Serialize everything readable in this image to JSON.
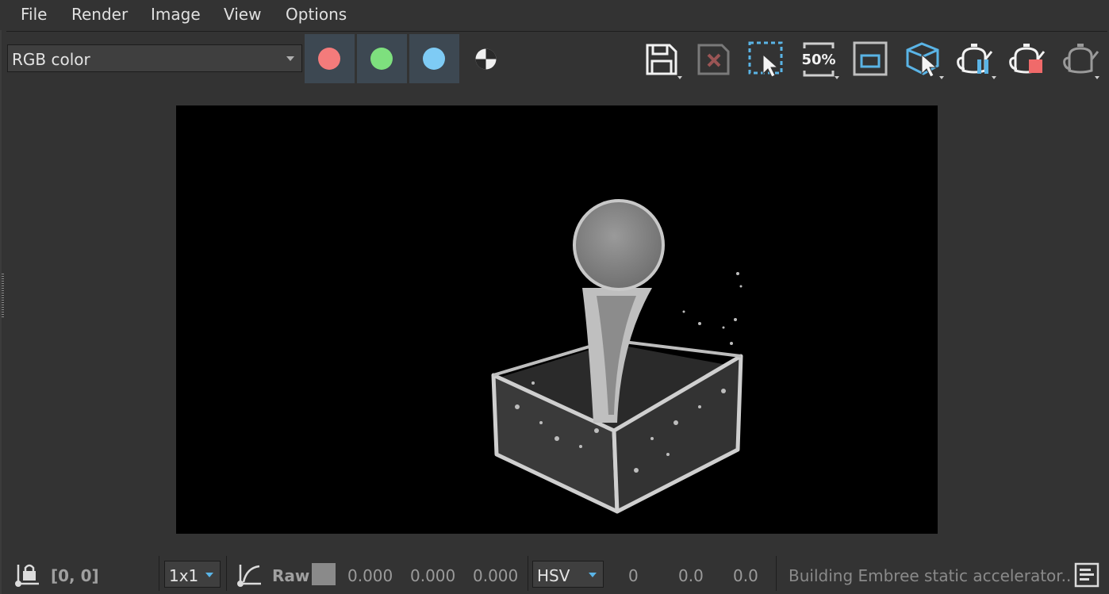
{
  "menubar": {
    "items": [
      "File",
      "Render",
      "Image",
      "View",
      "Options"
    ]
  },
  "toolbar": {
    "channel_display": "RGB color",
    "channel_buttons": [
      {
        "name": "red",
        "color": "#f47b7b"
      },
      {
        "name": "green",
        "color": "#7ee07e"
      },
      {
        "name": "blue",
        "color": "#7ecbf5"
      }
    ],
    "zoom_label": "50%",
    "icons": [
      "save-icon",
      "clear-icon",
      "region-select-icon",
      "zoom-50-icon",
      "frame-icon",
      "object-pick-icon",
      "render-pause-icon",
      "render-stop-icon",
      "render-icon"
    ],
    "accent_color": "#5ab4e6",
    "stop_color": "#f06a6a"
  },
  "viewport": {
    "background": "#000000"
  },
  "statusbar": {
    "coords": "[0, 0]",
    "sampling": "1x1",
    "raw_label": "Raw",
    "rgb_values": [
      "0.000",
      "0.000",
      "0.000"
    ],
    "color_space": "HSV",
    "hsv_values": [
      "0",
      "0.0",
      "0.0"
    ],
    "message": "Building Embree static accelerator.."
  }
}
